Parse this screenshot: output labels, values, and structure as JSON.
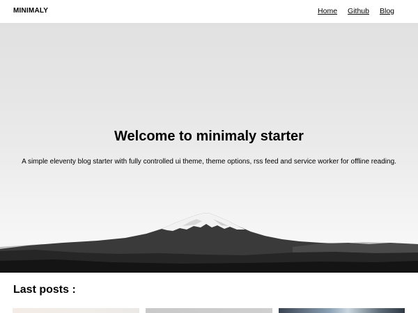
{
  "header": {
    "brand": "MINIMALY",
    "nav": [
      {
        "label": "Home"
      },
      {
        "label": "Github"
      },
      {
        "label": "Blog"
      }
    ]
  },
  "hero": {
    "title": "Welcome to minimaly starter",
    "subtitle": "A simple eleventy blog starter with fully controlled ui theme, theme options, rss feed and service worker for offline reading."
  },
  "posts": {
    "heading": "Last posts :",
    "cards": [
      {
        "image": "post-thumbnail-1"
      },
      {
        "image": "post-thumbnail-2"
      },
      {
        "image": "post-thumbnail-3"
      }
    ]
  }
}
